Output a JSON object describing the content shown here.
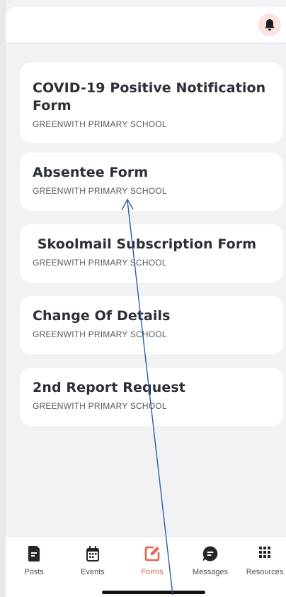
{
  "header": {
    "bell_icon": "bell-icon"
  },
  "forms": [
    {
      "title": "COVID-19 Positive Notification Form",
      "school": "GREENWITH PRIMARY SCHOOL"
    },
    {
      "title": "Absentee Form",
      "school": "GREENWITH PRIMARY SCHOOL"
    },
    {
      "title": " Skoolmail Subscription Form",
      "school": "GREENWITH PRIMARY SCHOOL"
    },
    {
      "title": "Change Of Details",
      "school": "GREENWITH PRIMARY SCHOOL"
    },
    {
      "title": "2nd Report Request",
      "school": "GREENWITH PRIMARY SCHOOL"
    }
  ],
  "tabs": [
    {
      "label": "Posts",
      "icon": "posts-icon",
      "active": false
    },
    {
      "label": "Events",
      "icon": "calendar-icon",
      "active": false
    },
    {
      "label": "Forms",
      "icon": "edit-form-icon",
      "active": true
    },
    {
      "label": "Messages",
      "icon": "message-icon",
      "active": false
    },
    {
      "label": "Resources",
      "icon": "grid-icon",
      "active": false
    }
  ],
  "colors": {
    "accent": "#e8624f",
    "text": "#2b2f36",
    "background": "#f2f2f4",
    "annotation": "#2a5ea8"
  }
}
